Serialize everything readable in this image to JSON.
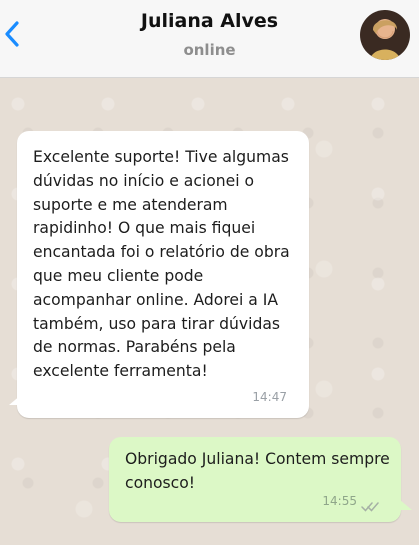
{
  "header": {
    "contact_name": "Juliana Alves",
    "status": "online",
    "back_icon": "chevron-left-icon",
    "accent_color": "#1a8cff"
  },
  "messages": [
    {
      "direction": "incoming",
      "text": "Excelente suporte! Tive algumas dúvidas no início e acionei o suporte e me atenderam rapidinho! O que mais fiquei encantada foi o relatório de obra que meu cliente pode acompanhar online. Adorei a IA também, uso para tirar dúvidas de normas. Parabéns pela excelente ferramenta!",
      "time": "14:47",
      "bubble_color": "#ffffff"
    },
    {
      "direction": "outgoing",
      "text": "Obrigado Juliana! Contem sempre conosco!",
      "time": "14:55",
      "status_icon": "double-check-icon",
      "bubble_color": "#dcf8c6"
    }
  ]
}
